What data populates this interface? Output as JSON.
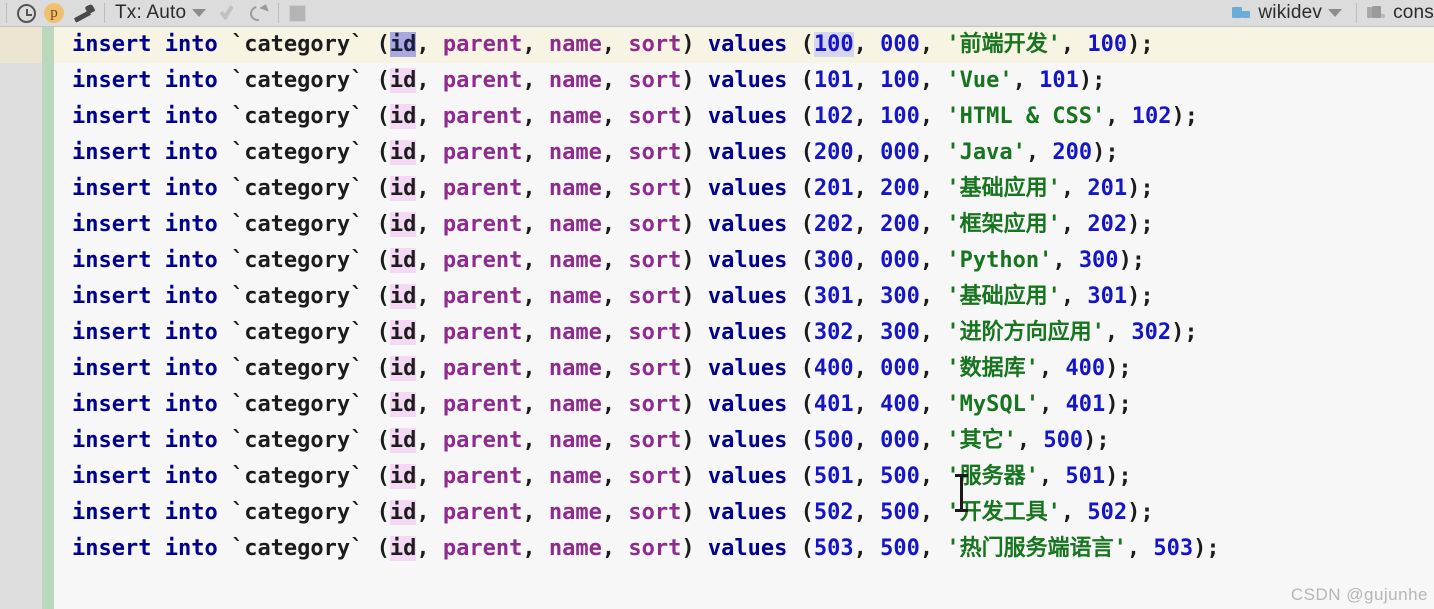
{
  "toolbar": {
    "icons": {
      "history": "clock-history-icon",
      "profile_badge": "p",
      "tools": "wrench-icon",
      "commit": "check-icon",
      "rollback": "rollback-icon",
      "stop": "stop-icon"
    },
    "tx_label": "Tx: Auto",
    "schema_label": "wikidev",
    "console_label": "cons"
  },
  "editor": {
    "table": "`category`",
    "keyword_insert": "insert into",
    "keyword_values": "values",
    "columns": [
      "id",
      "parent",
      "name",
      "sort"
    ],
    "lines": [
      {
        "id": "100",
        "parent": "000",
        "name": "'前端开发'",
        "sort": "100",
        "caret_line": true,
        "id_selected": true,
        "value_highlight": true
      },
      {
        "id": "101",
        "parent": "100",
        "name": "'Vue'",
        "sort": "101"
      },
      {
        "id": "102",
        "parent": "100",
        "name": "'HTML & CSS'",
        "sort": "102"
      },
      {
        "id": "200",
        "parent": "000",
        "name": "'Java'",
        "sort": "200"
      },
      {
        "id": "201",
        "parent": "200",
        "name": "'基础应用'",
        "sort": "201"
      },
      {
        "id": "202",
        "parent": "200",
        "name": "'框架应用'",
        "sort": "202"
      },
      {
        "id": "300",
        "parent": "000",
        "name": "'Python'",
        "sort": "300"
      },
      {
        "id": "301",
        "parent": "300",
        "name": "'基础应用'",
        "sort": "301"
      },
      {
        "id": "302",
        "parent": "300",
        "name": "'进阶方向应用'",
        "sort": "302"
      },
      {
        "id": "400",
        "parent": "000",
        "name": "'数据库'",
        "sort": "400"
      },
      {
        "id": "401",
        "parent": "400",
        "name": "'MySQL'",
        "sort": "401"
      },
      {
        "id": "500",
        "parent": "000",
        "name": "'其它'",
        "sort": "500"
      },
      {
        "id": "501",
        "parent": "500",
        "name": "'服务器'",
        "sort": "501"
      },
      {
        "id": "502",
        "parent": "500",
        "name": "'开发工具'",
        "sort": "502"
      },
      {
        "id": "503",
        "parent": "500",
        "name": "'热门服务端语言'",
        "sort": "503"
      }
    ]
  },
  "watermark": "CSDN @gujunhe",
  "colors": {
    "keyword": "#000090",
    "column": "#8f2a8f",
    "number": "#1414c8",
    "string": "#17741f",
    "selection": "#a9a9e0",
    "identifier_highlight": "#f3d9f3",
    "caret_line": "#f8f4e4",
    "vcs_modified": "#bcd8bc",
    "toolbar_bg": "#dcdcdc"
  }
}
